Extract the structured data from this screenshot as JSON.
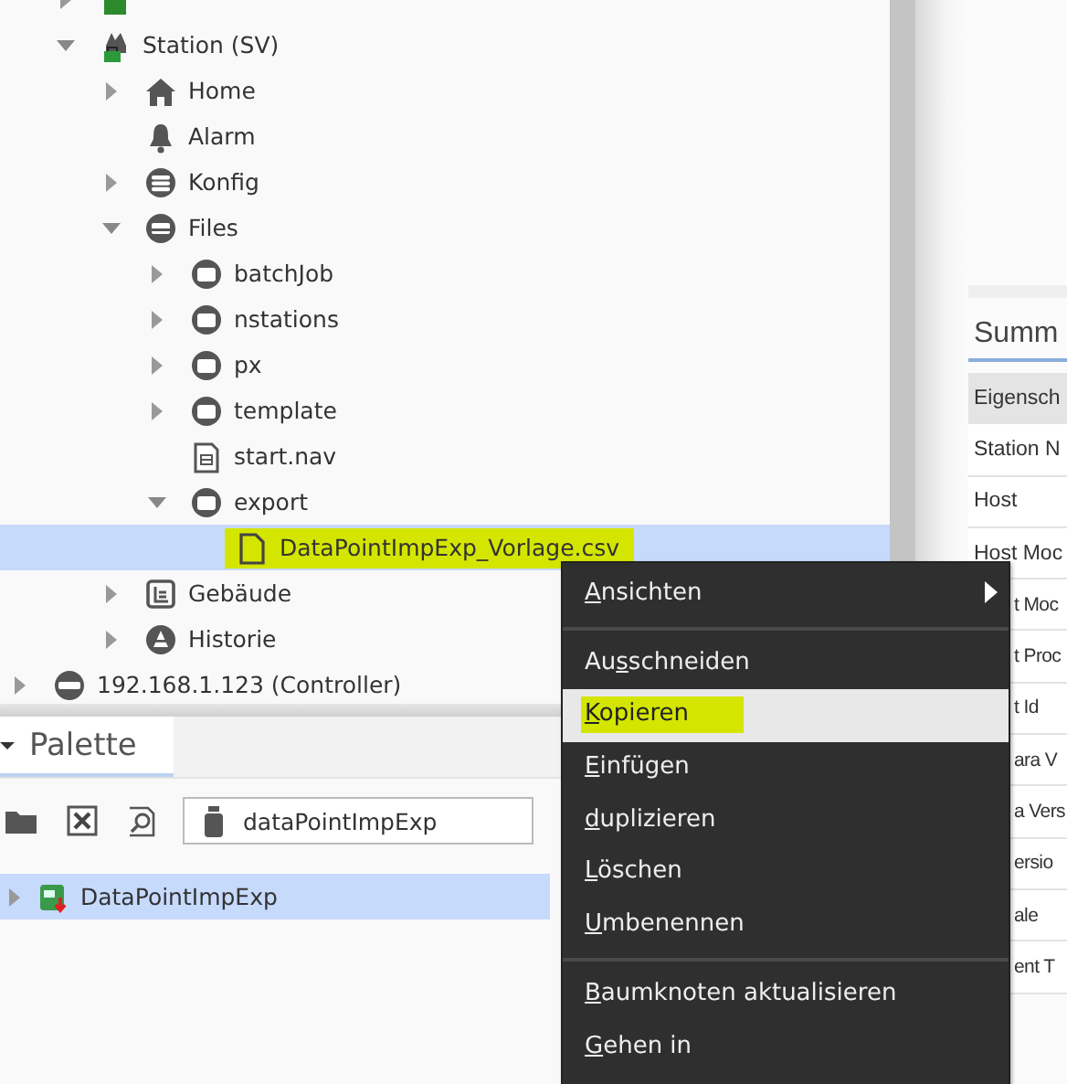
{
  "nav_tree": {
    "continued": [
      {
        "kind": "platform",
        "expanded": false,
        "selected": false
      },
      {
        "label": "Station (SV)",
        "kind": "station",
        "expanded": true,
        "selected": false,
        "children": [
          {
            "label": "Home",
            "kind": "home",
            "expanded": false,
            "selected": false
          },
          {
            "label": "Alarm",
            "kind": "alarm",
            "selected": false
          },
          {
            "label": "Konfig",
            "kind": "database",
            "expanded": false,
            "selected": false
          },
          {
            "label": "Files",
            "kind": "drive",
            "expanded": true,
            "selected": false,
            "children": [
              {
                "label": "batchJob",
                "kind": "folder",
                "expanded": false,
                "selected": false
              },
              {
                "label": "nstations",
                "kind": "folder",
                "expanded": false,
                "selected": false
              },
              {
                "label": "px",
                "kind": "folder",
                "expanded": false,
                "selected": false
              },
              {
                "label": "template",
                "kind": "folder",
                "expanded": false,
                "selected": false
              },
              {
                "label": "start.nav",
                "kind": "nav",
                "selected": false
              },
              {
                "label": "export",
                "kind": "folder",
                "expanded": true,
                "selected": false,
                "children": [
                  {
                    "label": "DataPointImpExp_Vorlage.csv",
                    "kind": "file",
                    "selected": true,
                    "highlighted": true
                  }
                ]
              }
            ]
          },
          {
            "label": "Gebäude",
            "kind": "building",
            "expanded": false,
            "selected": false
          },
          {
            "label": "Historie",
            "kind": "history",
            "expanded": false,
            "selected": false
          }
        ]
      }
    ],
    "items": [
      {
        "label": "192.168.1.123 (Controller)",
        "kind": "controller",
        "expanded": false,
        "selected": false
      }
    ]
  },
  "palette": {
    "tab": {
      "label": "Palette",
      "selected": true
    },
    "module_field": {
      "value": "dataPointImpExp"
    },
    "items": [
      {
        "label": "DataPointImpExp",
        "kind": "module",
        "expanded": false,
        "selected": true
      }
    ]
  },
  "summary": {
    "tab": {
      "label": "Summ",
      "selected": true
    },
    "header": "Eigensch",
    "rows": [
      "Station N",
      "Host",
      "Host Moc",
      "t Moc",
      "t Proc",
      "t Id",
      "ara V",
      "a Vers",
      "ersio",
      "ale",
      "ent T"
    ]
  },
  "context_menu": [
    {
      "kind": "item",
      "mnemonic": "A",
      "rest": "nsichten",
      "submenu": true,
      "selected": false
    },
    {
      "kind": "separator"
    },
    {
      "kind": "item",
      "prefix": "Au",
      "mnemonic": "s",
      "rest": "schneiden",
      "selected": false
    },
    {
      "kind": "item",
      "mnemonic": "K",
      "rest": "opieren",
      "selected": true,
      "highlighted": true
    },
    {
      "kind": "item",
      "mnemonic": "E",
      "rest": "infügen",
      "selected": false
    },
    {
      "kind": "item",
      "mnemonic": "d",
      "rest": "uplizieren",
      "selected": false
    },
    {
      "kind": "item",
      "mnemonic": "L",
      "rest": "öschen",
      "selected": false
    },
    {
      "kind": "item",
      "mnemonic": "U",
      "rest": "mbenennen",
      "selected": false
    },
    {
      "kind": "separator"
    },
    {
      "kind": "item",
      "mnemonic": "B",
      "rest": "aumknoten aktualisieren",
      "selected": false
    },
    {
      "kind": "item",
      "mnemonic": "G",
      "rest": "ehen in",
      "selected": false
    }
  ]
}
